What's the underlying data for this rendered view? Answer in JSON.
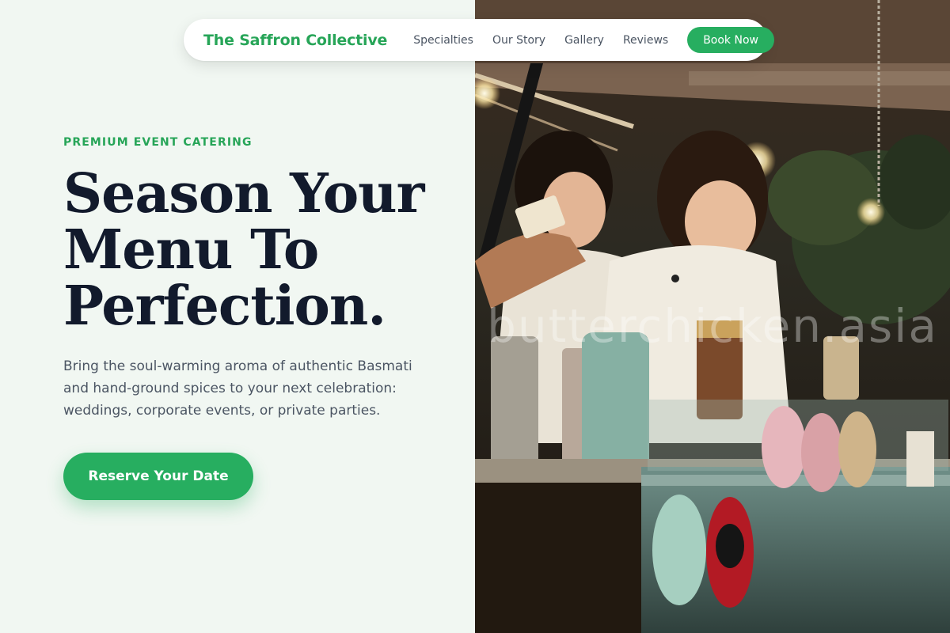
{
  "nav": {
    "brand": "The Saffron Collective",
    "links": [
      "Specialties",
      "Our Story",
      "Gallery",
      "Reviews"
    ],
    "book_label": "Book Now"
  },
  "hero": {
    "eyebrow": "PREMIUM EVENT CATERING",
    "headline_lines": [
      "Season Your",
      "Menu To",
      "Perfection."
    ],
    "lead": "Bring the soul-warming aroma of authentic Basmati and hand-ground spices to your next celebration: weddings, corporate events, or private parties.",
    "cta_label": "Reserve Your Date"
  },
  "photo": {
    "subject": "food-stall-photo",
    "watermark": "butterchicken.asia"
  },
  "colors": {
    "accent": "#27ae60",
    "heading": "#121a2c",
    "background": "#f1f7f2"
  }
}
